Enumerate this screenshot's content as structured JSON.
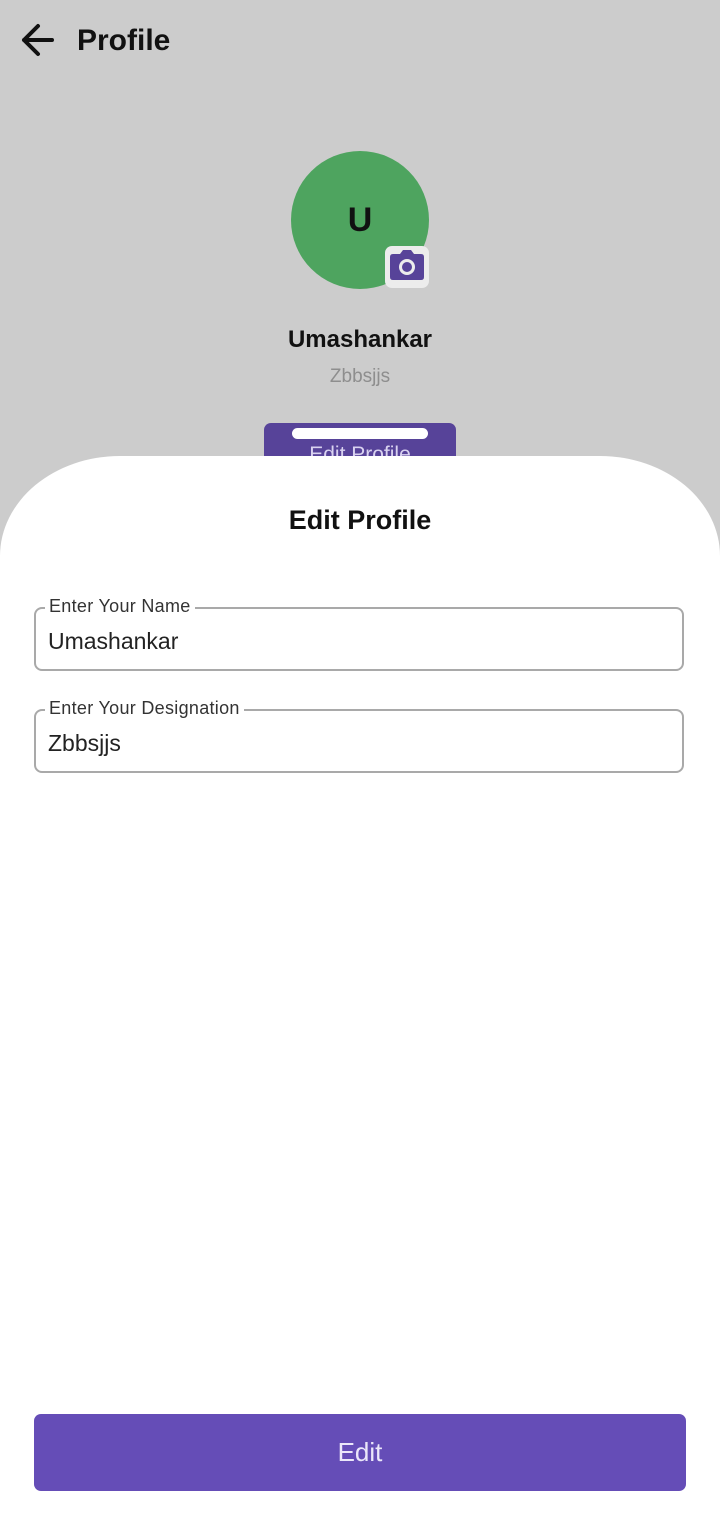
{
  "header": {
    "title": "Profile",
    "back_icon": "arrow-left-icon"
  },
  "profile": {
    "avatar_initial": "U",
    "avatar_color": "#4ea45f",
    "camera_icon": "camera-icon",
    "name": "Umashankar",
    "designation": "Zbbsjjs",
    "edit_profile_label": "Edit Profile"
  },
  "sheet": {
    "title": "Edit Profile",
    "fields": [
      {
        "label": "Enter Your Name",
        "value": "Umashankar"
      },
      {
        "label": "Enter Your Designation",
        "value": "Zbbsjjs"
      }
    ],
    "submit_label": "Edit"
  },
  "colors": {
    "accent": "#654db7",
    "accent_dark": "#574399",
    "scrim": "#cccccc"
  }
}
